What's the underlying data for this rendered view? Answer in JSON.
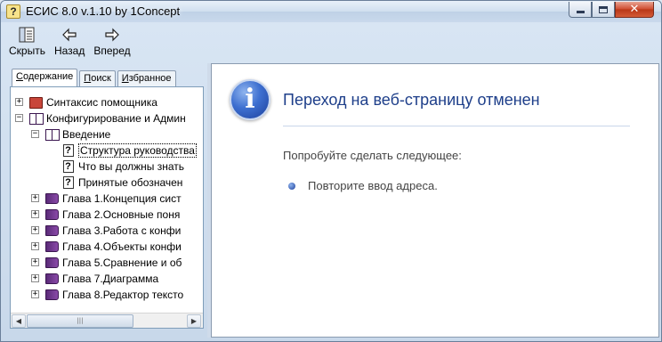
{
  "window": {
    "title": "ЕСИС 8.0 v.1.10 by 1Concept",
    "title_icon": "?",
    "close_glyph": "✕"
  },
  "toolbar": {
    "hide_label": "Скрыть",
    "back_label": "Назад",
    "forward_label": "Вперед"
  },
  "tabs": {
    "contents": {
      "first": "С",
      "rest": "одержание"
    },
    "search": {
      "first": "П",
      "rest": "оиск"
    },
    "favorites": {
      "first": "И",
      "rest": "збранное"
    }
  },
  "tree": {
    "items": [
      {
        "label": "Синтаксис помощника",
        "icon": "red-book-icon",
        "expander": "+"
      },
      {
        "label": "Конфигурирование и Админ",
        "icon": "open-book-icon",
        "expander": "−"
      },
      {
        "label": "Введение",
        "icon": "open-book-icon",
        "expander": "−"
      },
      {
        "label": "Структура руководства",
        "icon": "help-page-icon"
      },
      {
        "label": "Что вы должны знать",
        "icon": "help-page-icon"
      },
      {
        "label": "Принятые обозначен",
        "icon": "help-page-icon"
      },
      {
        "label": "Глава 1.Концепция сист",
        "icon": "closed-book-icon",
        "expander": "+"
      },
      {
        "label": "Глава 2.Основные поня",
        "icon": "closed-book-icon",
        "expander": "+"
      },
      {
        "label": "Глава 3.Работа с конфи",
        "icon": "closed-book-icon",
        "expander": "+"
      },
      {
        "label": "Глава 4.Объекты конфи",
        "icon": "closed-book-icon",
        "expander": "+"
      },
      {
        "label": "Глава 5.Сравнение и об",
        "icon": "closed-book-icon",
        "expander": "+"
      },
      {
        "label": "Глава 7.Диаграмма",
        "icon": "closed-book-icon",
        "expander": "+"
      },
      {
        "label": "Глава 8.Редактор тексто",
        "icon": "closed-book-icon",
        "expander": "+"
      }
    ],
    "tooltip": "Структура руководства"
  },
  "scrollbar": {
    "left_arrow": "◀",
    "right_arrow": "▶",
    "thumb_grip": "|||"
  },
  "content": {
    "title": "Переход на веб-страницу отменен",
    "subtitle": "Попробуйте сделать следующее:",
    "bullet_item": "Повторите ввод адреса.",
    "info_glyph": "i"
  }
}
